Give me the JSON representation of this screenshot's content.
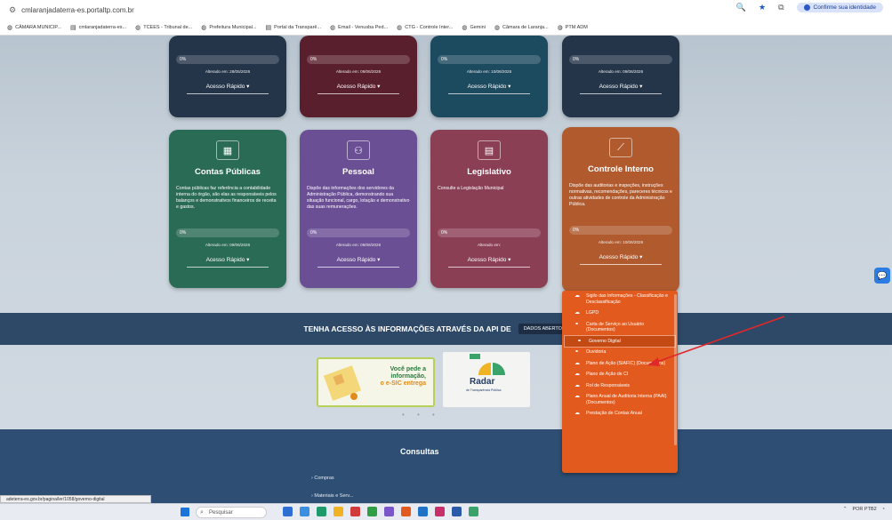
{
  "browser": {
    "url": "cmlaranjadaterra-es.portaltp.com.br",
    "confirm_identity": "Confirme sua identidade",
    "bookmarks": [
      {
        "icon": "globe-icon",
        "label": "CÂMARA MUNICIP..."
      },
      {
        "icon": "document-icon",
        "label": "cmlaranjadaterra-es..."
      },
      {
        "icon": "globe-icon",
        "label": "TCEES - Tribunal de..."
      },
      {
        "icon": "globe-icon",
        "label": "Prefeitura Municipal..."
      },
      {
        "icon": "document-icon",
        "label": "Portal da Transparê..."
      },
      {
        "icon": "globe-icon",
        "label": "Email - Venusba Ped..."
      },
      {
        "icon": "globe-icon",
        "label": "CTG - Controle Inter..."
      },
      {
        "icon": "globe-icon",
        "label": "Gemini"
      },
      {
        "icon": "globe-icon",
        "label": "Câmara de Laranja..."
      },
      {
        "icon": "globe-icon",
        "label": "PTM ADM"
      }
    ]
  },
  "cards_top": [
    {
      "progress": "0%",
      "changed": "Alterado em: 28/05/2026",
      "quick": "Acesso Rápido",
      "color": "#24354a"
    },
    {
      "progress": "0%",
      "changed": "Alterado em: 09/06/2026",
      "quick": "Acesso Rápido",
      "color": "#5a1f2d"
    },
    {
      "progress": "0%",
      "changed": "Alterado em: 10/06/2026",
      "quick": "Acesso Rápido",
      "color": "#1c4a5e"
    },
    {
      "progress": "0%",
      "changed": "Alterado em: 09/06/2026",
      "quick": "Acesso Rápido",
      "color": "#24354a"
    }
  ],
  "cards": [
    {
      "title": "Contas Públicas",
      "desc": "Contas públicas faz referência a contabilidade interna do órgão, são elas as responsáveis pelos balanços e demonstrativos financeiros de receita e gastos.",
      "progress": "0%",
      "changed": "Alterado em: 09/06/2026",
      "quick": "Acesso Rápido",
      "color": "#2a6b55",
      "icon": "building-icon"
    },
    {
      "title": "Pessoal",
      "desc": "Dispõe das informações dos servidores da Administração Pública, demonstrando sua situação funcional, cargo, lotação e demonstrativo das suas remunerações.",
      "progress": "0%",
      "changed": "Alterado em: 09/06/2026",
      "quick": "Acesso Rápido",
      "color": "#6b4f94",
      "icon": "people-icon"
    },
    {
      "title": "Legislativo",
      "desc": "Consulte a Legislação Municipal",
      "progress": "0%",
      "changed": "Alterado em:",
      "quick": "Acesso Rápido",
      "color": "#8a3f55",
      "icon": "document-icon"
    },
    {
      "title": "Controle Interno",
      "desc": "Dispõe das auditorias e inspeções, instruções normativas, recomendações, pareceres técnicos e outras atividades de controle da Administração Pública.",
      "progress": "0%",
      "changed": "Alterado em: 10/06/2026",
      "quick": "Acesso Rápido",
      "color": "#b05a2e",
      "icon": "chart-icon"
    }
  ],
  "api_band": {
    "text": "TENHA ACESSO ÀS INFORMAÇÕES ATRAVÉS DA API DE",
    "button": "DADOS ABERTOS"
  },
  "banner_esic": {
    "line1": "Você pede a",
    "line2": "informação,",
    "line3": "o e-SIC entrega"
  },
  "banner_radar": {
    "title": "Radar",
    "subtitle": "de Transparência Pública"
  },
  "footer": {
    "title": "Consultas",
    "link1": "› Compras",
    "link2": "› Materiais e Serv..."
  },
  "dropdown": [
    {
      "icon": "cloud-icon",
      "label": "Sigilo das Informações - Classificação e Desclassificação"
    },
    {
      "icon": "cloud-icon",
      "label": "LGPD"
    },
    {
      "icon": "link-icon",
      "label": "Carta de Serviço ao Usuário (Documentos)"
    },
    {
      "icon": "link-icon",
      "label": "Governo Digital"
    },
    {
      "icon": "link-icon",
      "label": "Ouvidoria"
    },
    {
      "icon": "cloud-icon",
      "label": "Plano de Ação (SIAFIC) (Documentos)"
    },
    {
      "icon": "cloud-icon",
      "label": "Plano de Ação de CI"
    },
    {
      "icon": "cloud-icon",
      "label": "Rol de Responsáveis"
    },
    {
      "icon": "cloud-icon",
      "label": "Plano Anual de Auditoria Interna (PAAI) (Documentos)"
    },
    {
      "icon": "cloud-icon",
      "label": "Prestação de Contas Anual"
    }
  ],
  "status_url": "adeterra-es.gov.br/pagina/ler/1058/governo-digital",
  "taskbar": {
    "search": "Pesquisar",
    "lang": "POR PTB2"
  }
}
